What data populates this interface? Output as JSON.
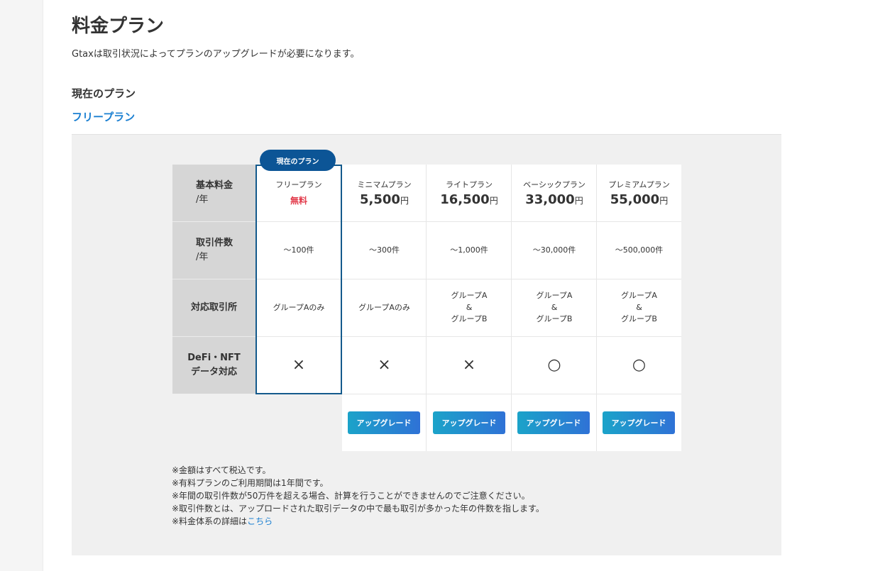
{
  "page": {
    "title": "料金プラン",
    "description": "Gtaxは取引状況によってプランのアップグレードが必要になります。",
    "current_plan_heading": "現在のプラン",
    "current_plan_name": "フリープラン"
  },
  "table": {
    "current_badge": "現在のプラン",
    "row_labels": [
      {
        "main": "基本料金",
        "unit": "/年"
      },
      {
        "main": "取引件数",
        "unit": "/年"
      },
      {
        "main": "対応取引所",
        "unit": ""
      },
      {
        "main": "DeFi・NFT",
        "unit": "データ対応"
      }
    ],
    "plans": [
      {
        "name": "フリープラン",
        "price_text": "無料",
        "price": "",
        "yen": "",
        "transactions": "〜100件",
        "exchanges": [
          "グループAのみ"
        ],
        "defi_nft": "×",
        "upgrade": ""
      },
      {
        "name": "ミニマムプラン",
        "price_text": "",
        "price": "5,500",
        "yen": "円",
        "transactions": "〜300件",
        "exchanges": [
          "グループAのみ"
        ],
        "defi_nft": "×",
        "upgrade": "アップグレード"
      },
      {
        "name": "ライトプラン",
        "price_text": "",
        "price": "16,500",
        "yen": "円",
        "transactions": "〜1,000件",
        "exchanges": [
          "グループA",
          "&",
          "グループB"
        ],
        "defi_nft": "×",
        "upgrade": "アップグレード"
      },
      {
        "name": "ベーシックプラン",
        "price_text": "",
        "price": "33,000",
        "yen": "円",
        "transactions": "〜30,000件",
        "exchanges": [
          "グループA",
          "&",
          "グループB"
        ],
        "defi_nft": "○",
        "upgrade": "アップグレード"
      },
      {
        "name": "プレミアムプラン",
        "price_text": "",
        "price": "55,000",
        "yen": "円",
        "transactions": "〜500,000件",
        "exchanges": [
          "グループA",
          "&",
          "グループB"
        ],
        "defi_nft": "○",
        "upgrade": "アップグレード"
      }
    ]
  },
  "notes": [
    "※金額はすべて税込です。",
    "※有料プランのご利用期間は1年間です。",
    "※年間の取引件数が50万件を超える場合、計算を行うことができませんのでご注意ください。",
    "※取引件数とは、アップロードされた取引データの中で最も取引が多かった年の件数を指します。"
  ],
  "pricing_note": {
    "prefix": "※料金体系の詳細は",
    "link": "こちら"
  },
  "colors": {
    "link": "#1a7fd1",
    "free_price": "#e23a4a",
    "current_frame": "#145a8c",
    "badge": "#0c5596",
    "button_gradient_start": "#1ba3c9",
    "button_gradient_end": "#2f72d6"
  }
}
